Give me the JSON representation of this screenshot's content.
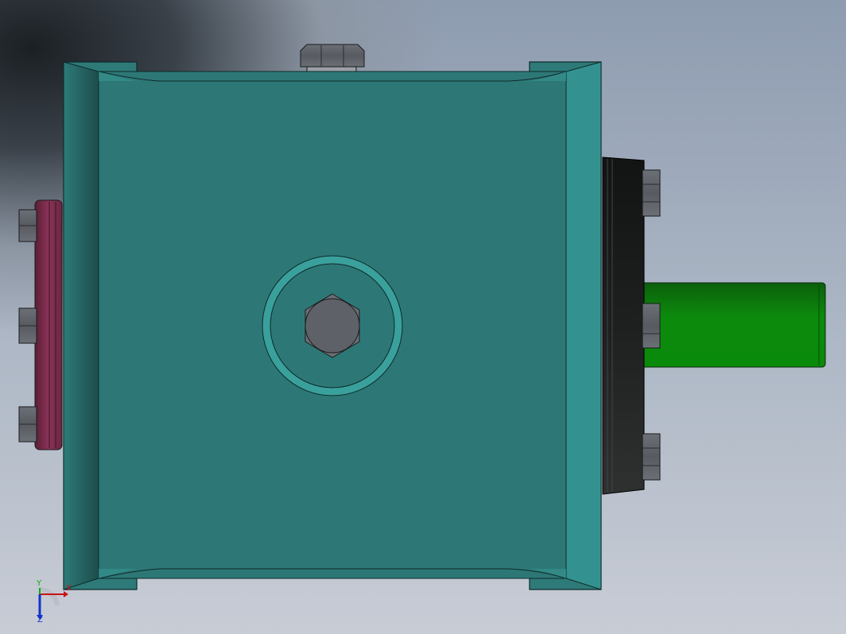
{
  "colors": {
    "housing": "#2e7a78",
    "housing_edge": "#328f8c",
    "housing_dark": "#1f5855",
    "flange_pink": "#7a2c4a",
    "shaft_green": "#0a8a0a",
    "cover_black": "#1a1c1c",
    "bolt_gray": "#5e6268",
    "axis_x": "#cc1111",
    "axis_y": "#11aa11",
    "axis_z": "#1133cc"
  },
  "triad": {
    "x_label": "X",
    "y_label": "Y",
    "z_label": "Z"
  }
}
